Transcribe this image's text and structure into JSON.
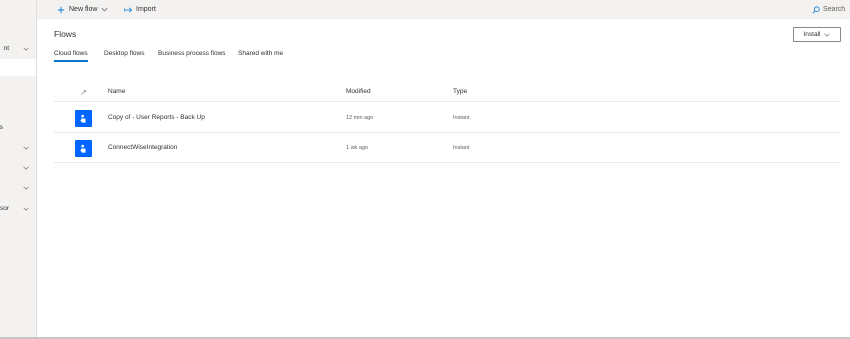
{
  "nav": {
    "items": [
      {
        "label": "nt",
        "has_chevron": true
      },
      {
        "label": "s",
        "has_chevron": false
      },
      {
        "label": "",
        "has_chevron": true
      },
      {
        "label": "",
        "has_chevron": true
      },
      {
        "label": "",
        "has_chevron": true
      },
      {
        "label": "visor",
        "has_chevron": true
      }
    ]
  },
  "commandbar": {
    "new_flow": "New flow",
    "import": "Import",
    "search": "Search"
  },
  "page": {
    "title": "Flows",
    "install_label": "Install"
  },
  "tabs": [
    {
      "label": "Cloud flows",
      "active": true
    },
    {
      "label": "Desktop flows",
      "active": false
    },
    {
      "label": "Business process flows",
      "active": false
    },
    {
      "label": "Shared with me",
      "active": false
    }
  ],
  "table": {
    "headers": {
      "name": "Name",
      "modified": "Modified",
      "type": "Type"
    },
    "rows": [
      {
        "name": "Copy of - User Reports - Back Up",
        "modified": "12 min ago",
        "type": "Instant",
        "icon": "touch-icon"
      },
      {
        "name": "ConnectWiseIntegration",
        "modified": "1 wk ago",
        "type": "Instant",
        "icon": "touch-icon"
      }
    ]
  },
  "colors": {
    "accent": "#0078d4",
    "flow_icon_bg": "#0066ff",
    "chrome_bg": "#f3f2f1"
  }
}
